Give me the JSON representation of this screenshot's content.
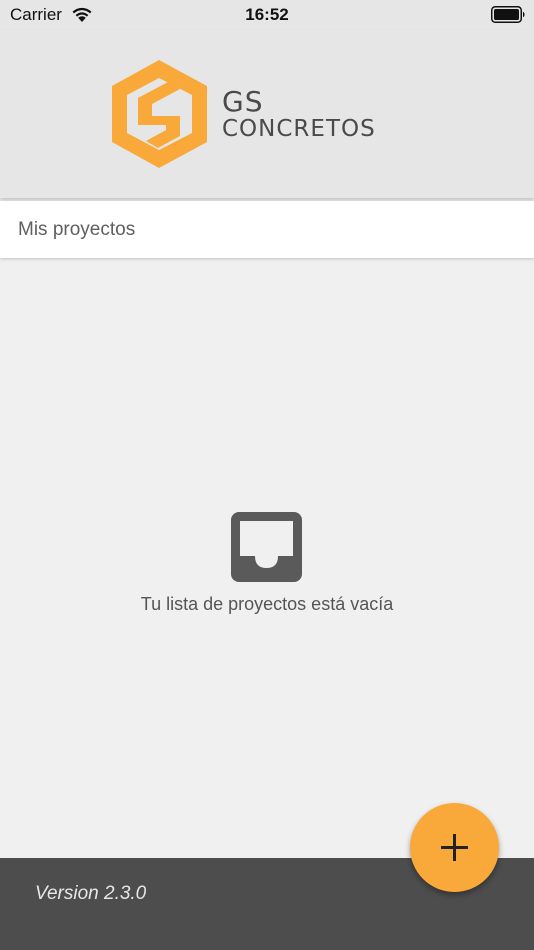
{
  "status_bar": {
    "carrier": "Carrier",
    "time": "16:52",
    "wifi_icon": "wifi-icon",
    "battery_icon": "battery-icon"
  },
  "header": {
    "brand_line1": "GS",
    "brand_line2": "CONCRETOS",
    "logo_icon": "gs-logo-icon",
    "brand_color": "#f8a939",
    "text_color": "#4a4a4a"
  },
  "title": "Mis proyectos",
  "empty_state": {
    "icon": "inbox-icon",
    "message": "Tu lista de proyectos está vacía"
  },
  "footer": {
    "version": "Version 2.3.0"
  },
  "fab": {
    "icon": "plus-icon",
    "color": "#f8a939"
  }
}
